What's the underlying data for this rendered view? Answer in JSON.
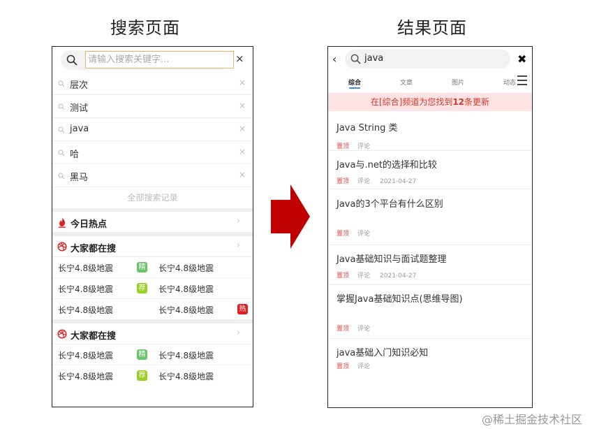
{
  "headings": {
    "left": "搜索页面",
    "right": "结果页面"
  },
  "colors": {
    "accent": "#3a8ee6",
    "hot_red": "#e02020",
    "badge_jing": "#6cc36a",
    "badge_jian": "#99d126",
    "banner_bg": "#fde3e3",
    "arrow": "#c00000"
  },
  "search_page": {
    "search_placeholder": "请输入搜索关键字...",
    "close_label": "×",
    "history": [
      {
        "text": "层次",
        "delete": "×"
      },
      {
        "text": "测试",
        "delete": "×"
      },
      {
        "text": "java",
        "delete": "×"
      },
      {
        "text": "哈",
        "delete": "×"
      },
      {
        "text": "黑马",
        "delete": "×"
      }
    ],
    "all_history_label": "全部搜索记录",
    "today_hot": {
      "title": "今日热点",
      "icon": "flame-icon"
    },
    "sections": [
      {
        "title": "大家都在搜",
        "icon": "dribbble-icon",
        "rows": [
          {
            "left": "长宁4.8级地震",
            "left_badge": "精",
            "right": "长宁4.8级地震",
            "right_badge": ""
          },
          {
            "left": "长宁4.8级地震",
            "left_badge": "荐",
            "right": "长宁4.8级地震",
            "right_badge": ""
          },
          {
            "left": "长宁4.8级地震",
            "left_badge": "",
            "right": "长宁4.8级地震",
            "right_badge": "热"
          }
        ]
      },
      {
        "title": "大家都在搜",
        "icon": "dribbble-icon",
        "rows": [
          {
            "left": "长宁4.8级地震",
            "left_badge": "精",
            "right": "长宁4.8级地震",
            "right_badge": ""
          },
          {
            "left": "长宁4.8级地震",
            "left_badge": "荐",
            "right": "长宁4.8级地震",
            "right_badge": ""
          }
        ]
      }
    ]
  },
  "result_page": {
    "back_label": "‹",
    "query": "java",
    "close_label": "✖",
    "tabs": [
      "综合",
      "文章",
      "图片",
      "动态"
    ],
    "banner": {
      "prefix": "在[综合]频道为您找到",
      "count": "12",
      "suffix": "条更新"
    },
    "results": [
      {
        "title": "Java String 类",
        "top": "置顶",
        "comment": "评论",
        "date": ""
      },
      {
        "title": "Java与.net的选择和比较",
        "top": "置顶",
        "comment": "评论",
        "date": "2021-04-27"
      },
      {
        "title": "Java的3个平台有什么区别",
        "top": "置顶",
        "comment": "评论",
        "date": ""
      },
      {
        "title": "Java基础知识与面试题整理",
        "top": "置顶",
        "comment": "评论",
        "date": "2021-04-27"
      },
      {
        "title": "掌握Java基础知识点(思维导图)",
        "top": "置顶",
        "comment": "评论",
        "date": ""
      },
      {
        "title": "java基础入门知识必知",
        "top": "置顶",
        "comment": "评论",
        "date": ""
      }
    ]
  },
  "watermark": "@稀土掘金技术社区"
}
